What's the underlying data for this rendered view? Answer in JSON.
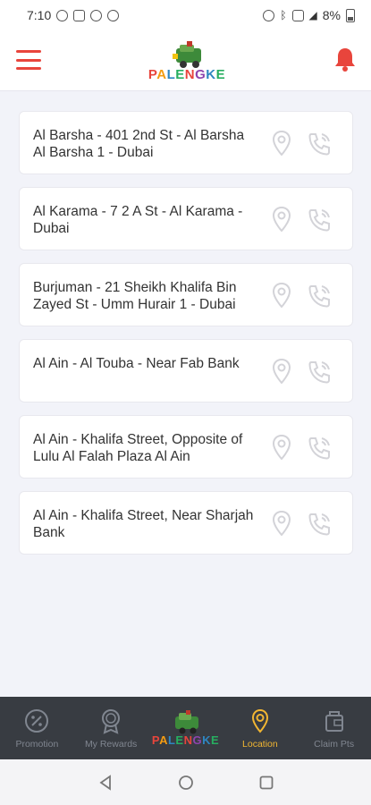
{
  "status": {
    "time": "7:10",
    "battery": "8%"
  },
  "brand": {
    "letters": [
      "P",
      "A",
      "L",
      "E",
      "N",
      "G",
      "K",
      "E"
    ]
  },
  "locations": [
    {
      "address": "Al Barsha - 401 2nd St - Al Barsha Al Barsha 1 - Dubai"
    },
    {
      "address": "Al Karama - 7 2 A St - Al Karama - Dubai"
    },
    {
      "address": "Burjuman - 21 Sheikh Khalifa Bin Zayed St - Umm Hurair 1 - Dubai"
    },
    {
      "address": "Al Ain - Al Touba - Near Fab Bank"
    },
    {
      "address": "Al Ain - Khalifa Street, Opposite of Lulu Al Falah Plaza Al Ain"
    },
    {
      "address": "Al Ain - Khalifa Street, Near Sharjah Bank"
    }
  ],
  "bottom_nav": {
    "promotion": "Promotion",
    "rewards": "My Rewards",
    "location": "Location",
    "claim": "Claim Pts"
  },
  "colors": {
    "accent": "#e8453c",
    "active_nav": "#f2b632",
    "nav_bg": "#383c42"
  }
}
